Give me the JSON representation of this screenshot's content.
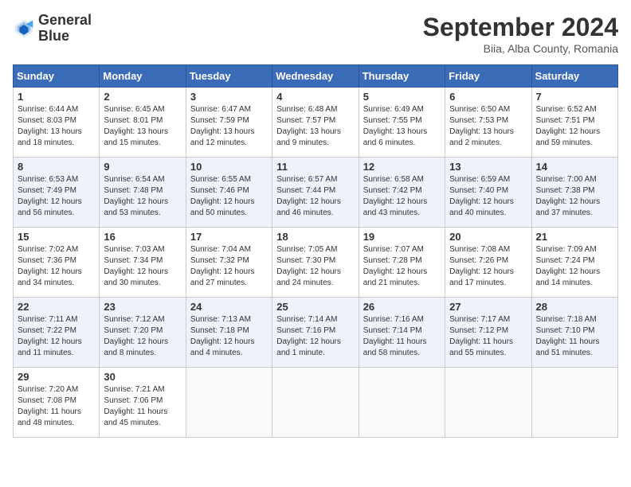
{
  "logo": {
    "line1": "General",
    "line2": "Blue"
  },
  "title": "September 2024",
  "location": "Biia, Alba County, Romania",
  "weekdays": [
    "Sunday",
    "Monday",
    "Tuesday",
    "Wednesday",
    "Thursday",
    "Friday",
    "Saturday"
  ],
  "weeks": [
    [
      {
        "day": "1",
        "sunrise": "6:44 AM",
        "sunset": "8:03 PM",
        "daylight": "13 hours and 18 minutes."
      },
      {
        "day": "2",
        "sunrise": "6:45 AM",
        "sunset": "8:01 PM",
        "daylight": "13 hours and 15 minutes."
      },
      {
        "day": "3",
        "sunrise": "6:47 AM",
        "sunset": "7:59 PM",
        "daylight": "13 hours and 12 minutes."
      },
      {
        "day": "4",
        "sunrise": "6:48 AM",
        "sunset": "7:57 PM",
        "daylight": "13 hours and 9 minutes."
      },
      {
        "day": "5",
        "sunrise": "6:49 AM",
        "sunset": "7:55 PM",
        "daylight": "13 hours and 6 minutes."
      },
      {
        "day": "6",
        "sunrise": "6:50 AM",
        "sunset": "7:53 PM",
        "daylight": "13 hours and 2 minutes."
      },
      {
        "day": "7",
        "sunrise": "6:52 AM",
        "sunset": "7:51 PM",
        "daylight": "12 hours and 59 minutes."
      }
    ],
    [
      {
        "day": "8",
        "sunrise": "6:53 AM",
        "sunset": "7:49 PM",
        "daylight": "12 hours and 56 minutes."
      },
      {
        "day": "9",
        "sunrise": "6:54 AM",
        "sunset": "7:48 PM",
        "daylight": "12 hours and 53 minutes."
      },
      {
        "day": "10",
        "sunrise": "6:55 AM",
        "sunset": "7:46 PM",
        "daylight": "12 hours and 50 minutes."
      },
      {
        "day": "11",
        "sunrise": "6:57 AM",
        "sunset": "7:44 PM",
        "daylight": "12 hours and 46 minutes."
      },
      {
        "day": "12",
        "sunrise": "6:58 AM",
        "sunset": "7:42 PM",
        "daylight": "12 hours and 43 minutes."
      },
      {
        "day": "13",
        "sunrise": "6:59 AM",
        "sunset": "7:40 PM",
        "daylight": "12 hours and 40 minutes."
      },
      {
        "day": "14",
        "sunrise": "7:00 AM",
        "sunset": "7:38 PM",
        "daylight": "12 hours and 37 minutes."
      }
    ],
    [
      {
        "day": "15",
        "sunrise": "7:02 AM",
        "sunset": "7:36 PM",
        "daylight": "12 hours and 34 minutes."
      },
      {
        "day": "16",
        "sunrise": "7:03 AM",
        "sunset": "7:34 PM",
        "daylight": "12 hours and 30 minutes."
      },
      {
        "day": "17",
        "sunrise": "7:04 AM",
        "sunset": "7:32 PM",
        "daylight": "12 hours and 27 minutes."
      },
      {
        "day": "18",
        "sunrise": "7:05 AM",
        "sunset": "7:30 PM",
        "daylight": "12 hours and 24 minutes."
      },
      {
        "day": "19",
        "sunrise": "7:07 AM",
        "sunset": "7:28 PM",
        "daylight": "12 hours and 21 minutes."
      },
      {
        "day": "20",
        "sunrise": "7:08 AM",
        "sunset": "7:26 PM",
        "daylight": "12 hours and 17 minutes."
      },
      {
        "day": "21",
        "sunrise": "7:09 AM",
        "sunset": "7:24 PM",
        "daylight": "12 hours and 14 minutes."
      }
    ],
    [
      {
        "day": "22",
        "sunrise": "7:11 AM",
        "sunset": "7:22 PM",
        "daylight": "12 hours and 11 minutes."
      },
      {
        "day": "23",
        "sunrise": "7:12 AM",
        "sunset": "7:20 PM",
        "daylight": "12 hours and 8 minutes."
      },
      {
        "day": "24",
        "sunrise": "7:13 AM",
        "sunset": "7:18 PM",
        "daylight": "12 hours and 4 minutes."
      },
      {
        "day": "25",
        "sunrise": "7:14 AM",
        "sunset": "7:16 PM",
        "daylight": "12 hours and 1 minute."
      },
      {
        "day": "26",
        "sunrise": "7:16 AM",
        "sunset": "7:14 PM",
        "daylight": "11 hours and 58 minutes."
      },
      {
        "day": "27",
        "sunrise": "7:17 AM",
        "sunset": "7:12 PM",
        "daylight": "11 hours and 55 minutes."
      },
      {
        "day": "28",
        "sunrise": "7:18 AM",
        "sunset": "7:10 PM",
        "daylight": "11 hours and 51 minutes."
      }
    ],
    [
      {
        "day": "29",
        "sunrise": "7:20 AM",
        "sunset": "7:08 PM",
        "daylight": "11 hours and 48 minutes."
      },
      {
        "day": "30",
        "sunrise": "7:21 AM",
        "sunset": "7:06 PM",
        "daylight": "11 hours and 45 minutes."
      },
      null,
      null,
      null,
      null,
      null
    ]
  ]
}
